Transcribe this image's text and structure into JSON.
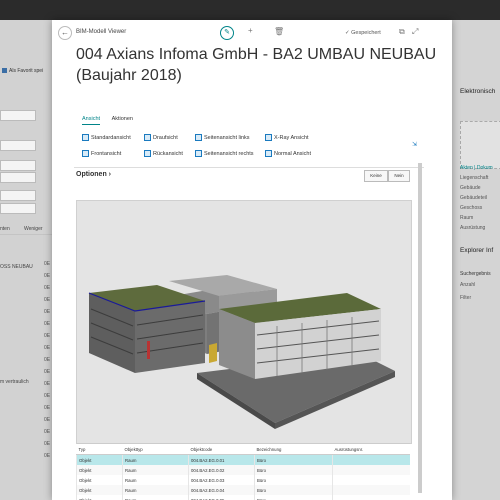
{
  "background": {
    "left": {
      "favorite_label": "Als Favorit spei",
      "texts": [
        "nten",
        "Weniger",
        "OSS NEUBAU",
        "m vertraulich"
      ],
      "dots": [
        "0E",
        "0E",
        "0E",
        "0E",
        "0E",
        "0E",
        "0E",
        "0E",
        "0E",
        "0E",
        "0E",
        "0E",
        "0E",
        "0E",
        "0E",
        "0E",
        "0E"
      ]
    },
    "right": {
      "heading1": "Elektronisch",
      "link": "Akten | Dokum",
      "list": [
        "Liegenschaft",
        "Gebäude",
        "Gebäudeteil",
        "Geschoss",
        "Raum",
        "Ausrüstung"
      ],
      "heading2": "Explorer Inf",
      "section": "Suchergebnis",
      "list2": [
        "Anzahl",
        "Filter"
      ]
    }
  },
  "modal": {
    "breadcrumb": "BIM-Modell Viewer",
    "saved": "Gespeichert",
    "title": "004 Axians Infoma GmbH -          BA2 UMBAU NEUBAU (Baujahr 2018)",
    "tabs": [
      {
        "label": "Ansicht",
        "active": true
      },
      {
        "label": "Aktionen",
        "active": false
      }
    ],
    "actions": {
      "standard": "Standardansicht",
      "top": "Draufsicht",
      "left": "Seitenansicht links",
      "xray": "X-Ray Ansicht",
      "front": "Frontansicht",
      "back": "Rückansicht",
      "right": "Seitenansicht rechts",
      "normal": "Normal Ansicht"
    },
    "options_label": "Optionen",
    "seg_none": "Keine",
    "seg_no": "Nein",
    "table": {
      "headers": [
        "Typ",
        "Objekttyp",
        "Objektcode",
        "Bezeichnung",
        "Ausrüstungsnr."
      ],
      "rows": [
        [
          "Objekt",
          "Raum",
          "004.BA2.EG.0.01",
          "Büro",
          ""
        ],
        [
          "Objekt",
          "Raum",
          "004.BA2.EG.0.02",
          "Büro",
          ""
        ],
        [
          "Objekt",
          "Raum",
          "004.BA2.EG.0.03",
          "Büro",
          ""
        ],
        [
          "Objekt",
          "Raum",
          "004.BA2.EG.0.04",
          "Büro",
          ""
        ],
        [
          "Objekt",
          "Raum",
          "004.BA2.EG.0.05",
          "Büro",
          ""
        ],
        [
          "Objekt",
          "Raum",
          "004.BA2.EG.0.06",
          "Büro",
          ""
        ]
      ]
    }
  },
  "colors": {
    "accent": "#008489",
    "link": "#1a7abf",
    "selected_row": "#b8e7ea"
  }
}
